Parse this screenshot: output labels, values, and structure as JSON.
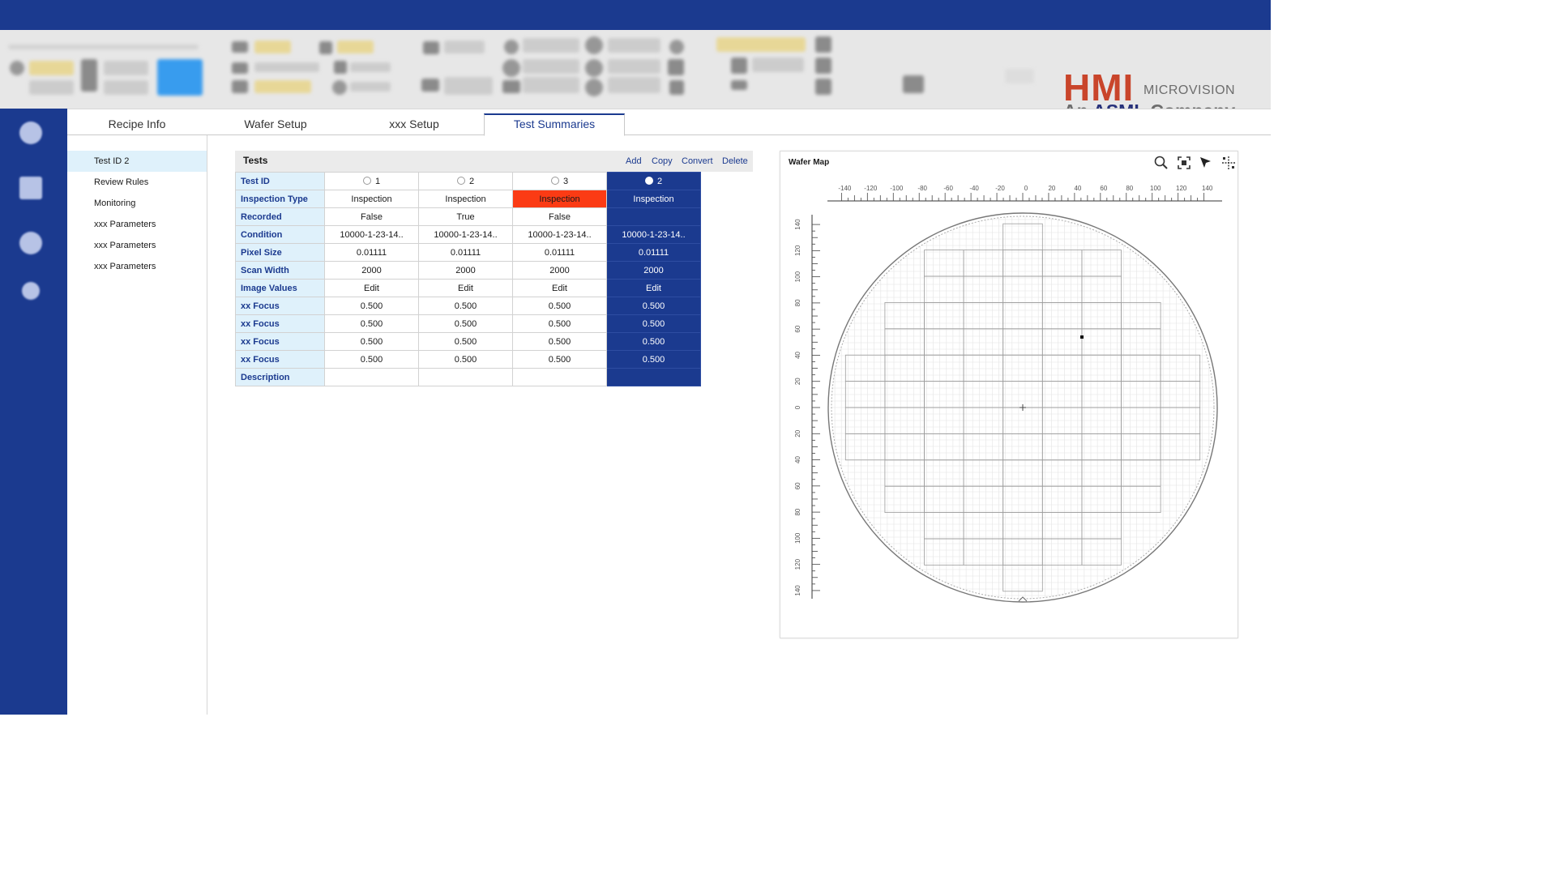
{
  "brand": {
    "name": "HMI",
    "division": "MICROVISION",
    "tagline_prefix": "An",
    "tagline_company": "ASML",
    "tagline_suffix": "Company",
    "accent": "#1b3a8f",
    "logo_red": "#c9452b"
  },
  "tabs": [
    {
      "label": "Recipe Info"
    },
    {
      "label": "Wafer Setup"
    },
    {
      "label": "xxx Setup"
    },
    {
      "label": "Test Summaries",
      "active": true
    }
  ],
  "sidebar": {
    "items": [
      {
        "label": "Test ID 2",
        "selected": true
      },
      {
        "label": "Review Rules"
      },
      {
        "label": "Monitoring"
      },
      {
        "label": "xxx Parameters"
      },
      {
        "label": "xxx Parameters"
      },
      {
        "label": "xxx Parameters"
      }
    ]
  },
  "tests": {
    "title": "Tests",
    "actions": {
      "add": "Add",
      "copy": "Copy",
      "convert": "Convert",
      "delete": "Delete"
    },
    "row_headers": [
      "Test ID",
      "Inspection Type",
      "Recorded",
      "Condition",
      "Pixel Size",
      "Scan Width",
      "Image Values",
      "xx Focus",
      "xx Focus",
      "xx Focus",
      "xx Focus",
      "Description"
    ],
    "columns": [
      {
        "id": "1",
        "selected": false,
        "highlight": false,
        "values": [
          "Inspection",
          "False",
          "10000-1-23-14..",
          "0.01111",
          "2000",
          "Edit",
          "0.500",
          "0.500",
          "0.500",
          "0.500",
          ""
        ]
      },
      {
        "id": "2",
        "selected": false,
        "highlight": false,
        "values": [
          "Inspection",
          "True",
          "10000-1-23-14..",
          "0.01111",
          "2000",
          "Edit",
          "0.500",
          "0.500",
          "0.500",
          "0.500",
          ""
        ]
      },
      {
        "id": "3",
        "selected": false,
        "highlight": true,
        "values": [
          "Inspection",
          "False",
          "10000-1-23-14..",
          "0.01111",
          "2000",
          "Edit",
          "0.500",
          "0.500",
          "0.500",
          "0.500",
          ""
        ]
      },
      {
        "id": "2",
        "selected": true,
        "highlight": false,
        "values": [
          "Inspection",
          "",
          "10000-1-23-14..",
          "0.01111",
          "2000",
          "Edit",
          "0.500",
          "0.500",
          "0.500",
          "0.500",
          ""
        ]
      }
    ],
    "colors": {
      "row_header_bg": "#dff1fb",
      "selected_col": "#1b3a8f",
      "error_cell": "#fb3b14"
    }
  },
  "wafer_map": {
    "title": "Wafer Map",
    "icons": [
      "zoom-icon",
      "fit-view-icon",
      "select-pointer-icon",
      "grid-view-icon"
    ],
    "x_ticks": [
      "-140",
      "-120",
      "-100",
      "-80",
      "-60",
      "-40",
      "-20",
      "0",
      "20",
      "40",
      "60",
      "80",
      "100",
      "120",
      "140"
    ],
    "y_ticks": [
      "140",
      "120",
      "100",
      "80",
      "60",
      "40",
      "20",
      "0",
      "20",
      "40",
      "60",
      "80",
      "100",
      "120",
      "140"
    ]
  }
}
